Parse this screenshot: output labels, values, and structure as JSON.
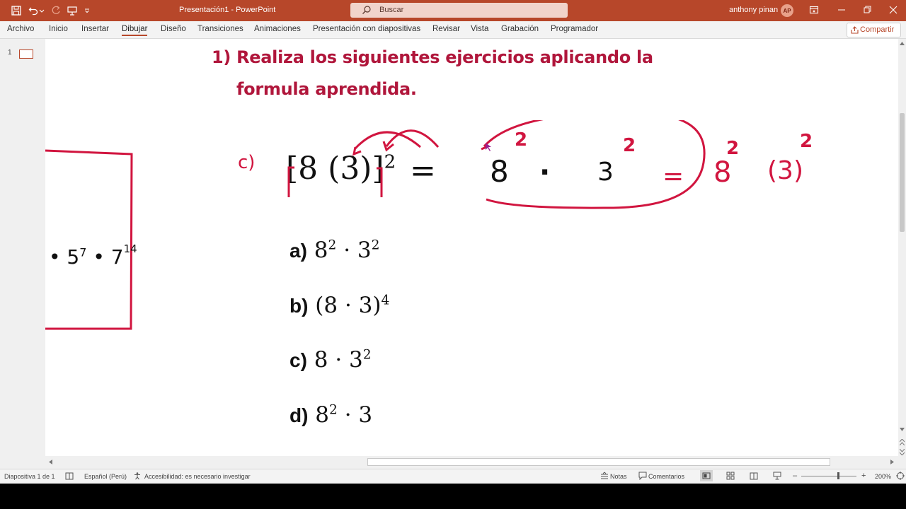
{
  "window": {
    "title": "Presentación1  -  PowerPoint",
    "search_placeholder": "Buscar",
    "user_name": "anthony pinan",
    "user_initials": "AP"
  },
  "ribbon": {
    "tabs": [
      "Archivo",
      "Inicio",
      "Insertar",
      "Dibujar",
      "Diseño",
      "Transiciones",
      "Animaciones",
      "Presentación con diapositivas",
      "Revisar",
      "Vista",
      "Grabación",
      "Programador"
    ],
    "active_tab": "Dibujar",
    "share_label": "Compartir"
  },
  "thumbnails": {
    "slide_number": "1"
  },
  "slide": {
    "heading_line1": "1) Realiza los siguientes ejercicios aplicando la",
    "heading_line2": "formula aprendida.",
    "problem": {
      "label": "c)",
      "expr_base": "[8 (3)]",
      "expr_exp": "2",
      "equals": "="
    },
    "ink": {
      "circled_base1": "8",
      "circled_exp1": "2",
      "dot": "·",
      "circled_base2": "3",
      "circled_exp2": "2",
      "equals": "=",
      "result_base1": "8",
      "result_exp1": "2",
      "result_base2": "(3)",
      "result_exp2": "2",
      "left_box_text": "• 5",
      "left_box_exp1": "7",
      "left_box_mid": "• 7",
      "left_box_exp2": "14"
    },
    "options": [
      {
        "label": "a)",
        "pre": "8",
        "e1": "2",
        "mid": " · 3",
        "e2": "2",
        "post": ""
      },
      {
        "label": "b)",
        "pre": "(8 · 3)",
        "e1": "4",
        "mid": "",
        "e2": "",
        "post": ""
      },
      {
        "label": "c)",
        "pre": "8 · 3",
        "e1": "2",
        "mid": "",
        "e2": "",
        "post": ""
      },
      {
        "label": "d)",
        "pre": "8",
        "e1": "2",
        "mid": " · 3",
        "e2": "",
        "post": ""
      }
    ]
  },
  "status": {
    "slide_info": "Diapositiva 1 de 1",
    "language": "Español (Perú)",
    "accessibility": "Accesibilidad: es necesario investigar",
    "notes": "Notas",
    "comments": "Comentarios",
    "zoom": "200%"
  },
  "colors": {
    "accent": "#b7472a",
    "ink_red": "#d1153f",
    "heading_red": "#b0163b"
  }
}
